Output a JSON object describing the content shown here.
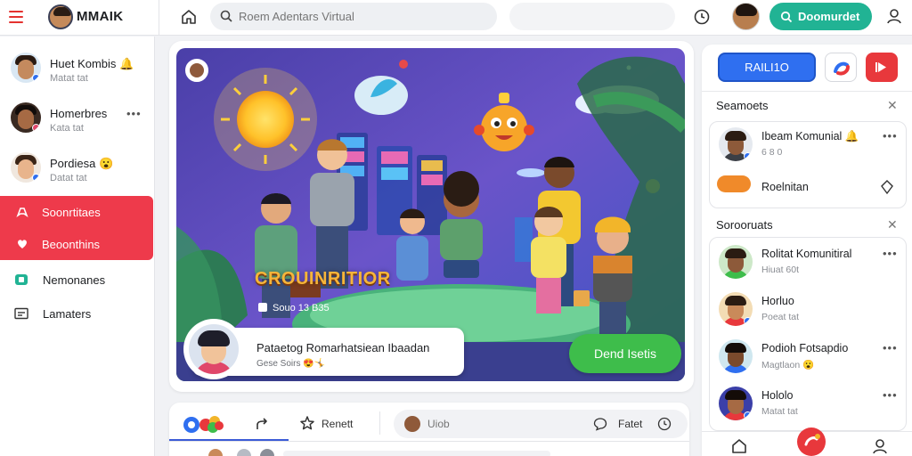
{
  "header": {
    "logo_text": "MMAIK",
    "search_placeholder": "Roem Adentars Virtual",
    "doc_button": "Doomurdet"
  },
  "left_sidebar": {
    "chats": [
      {
        "name": "Huet Kombis",
        "emoji": "🔔",
        "sub": "Matat tat"
      },
      {
        "name": "Homerbres",
        "sub": "Kata tat"
      },
      {
        "name": "Pordiesa",
        "emoji": "😮",
        "sub": "Datat tat"
      }
    ],
    "nav": [
      {
        "label": "Soonrtitaes",
        "active": true
      },
      {
        "label": "Beoonthins",
        "active": true
      },
      {
        "label": "Nemonanes",
        "active": false
      },
      {
        "label": "Lamaters",
        "active": false
      }
    ]
  },
  "hero": {
    "title": "CROUINRITIOR",
    "meta": "Souo 13 B35",
    "host_title": "Pataetog Romarhatsiean Ibaadan",
    "host_sub": "Gese Soirs",
    "host_emoji": "😍🤸",
    "cta": "Dend Isetis"
  },
  "actions": {
    "remind": "Renett",
    "comment_placeholder": "Uiob",
    "translate": "Fatet"
  },
  "right_col": {
    "primary_button": "RAILI1O",
    "section1_title": "Seamoets",
    "section1_items": [
      {
        "name": "Ibeam Komunial",
        "emoji": "🔔",
        "sub": "6 8 0"
      },
      {
        "name": "Roelnitan",
        "sub": ""
      }
    ],
    "section2_title": "Sorooruats",
    "section2_items": [
      {
        "name": "Rolitat Komunitiral",
        "sub": "Hiuat 60t"
      },
      {
        "name": "Horluo",
        "sub": "Poeat tat"
      },
      {
        "name": "Podioh Fotsapdio",
        "sub": "Magtlaon",
        "emoji": "😮"
      },
      {
        "name": "Hololo",
        "sub": "Matat tat"
      }
    ]
  },
  "colors": {
    "accent_red": "#ee3a4b",
    "accent_teal": "#21b394",
    "accent_blue": "#2f6ff0",
    "accent_green": "#3ebd4b"
  }
}
